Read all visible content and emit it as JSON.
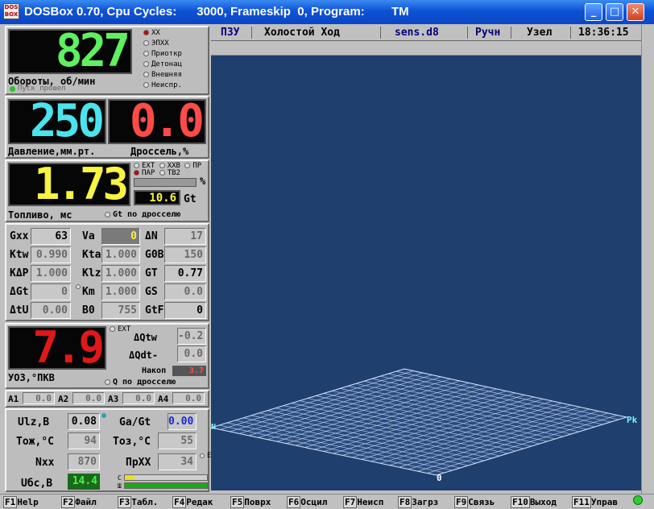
{
  "window": {
    "title": "DOSBox 0.70, Cpu Cycles:      3000, Frameskip  0, Program:        TM",
    "icon_text": [
      "DOS",
      "BOX"
    ]
  },
  "rpm": {
    "value": "827",
    "label": "Обороты, об/мин",
    "start_label": "Пуск прошел"
  },
  "modes": [
    "XX",
    "ЭПХХ",
    "Приоткр",
    "Детонац",
    "Внешняя",
    "Неиспр."
  ],
  "pressure": {
    "value": "250",
    "label": "Давление,мм.рт."
  },
  "throttle": {
    "value": "0.0",
    "label": "Дроссель,%"
  },
  "fuel": {
    "value": "1.73",
    "label": "Топливо, мс",
    "gt_value": "10.6",
    "gt_label": "Gt",
    "gt_throttle_label": "Gt по дросселю",
    "options": [
      "EXT",
      "XXB",
      "ПР",
      "ПАР",
      "ТВ2"
    ],
    "percent_label": "%"
  },
  "params": [
    {
      "n1": "Gxx",
      "v1": "63",
      "n2": "Va",
      "v2": "0",
      "n3": "ΔN",
      "v3": "17"
    },
    {
      "n1": "Ktw",
      "v1": "0.990",
      "n2": "Kta",
      "v2": "1.000",
      "n3": "G0B",
      "v3": "150"
    },
    {
      "n1": "KΔP",
      "v1": "1.000",
      "n2": "Klz",
      "v2": "1.000",
      "n3": "GT",
      "v3": "0.77"
    },
    {
      "n1": "ΔGt",
      "v1": "0",
      "n2": "Km",
      "v2": "1.000",
      "n3": "GS",
      "v3": "0.0"
    },
    {
      "n1": "ΔtU",
      "v1": "0.00",
      "n2": "B0",
      "v2": "755",
      "n3": "GtF",
      "v3": "0"
    }
  ],
  "ignition": {
    "value": "7.9",
    "label": "УОЗ,°ПКВ",
    "ext_label": "EXT",
    "dqtw_label": "ΔQtw",
    "dqtw_value": "-0.2",
    "dqdt_label": "ΔQdt-",
    "dqdt_value": "0.0",
    "nakop_label": "Накоп",
    "nakop_value": "3.7",
    "q_throttle_label": "Q по дросселю"
  },
  "a_vals": [
    {
      "name": "A1",
      "value": "0.0"
    },
    {
      "name": "A2",
      "value": "0.0"
    },
    {
      "name": "A3",
      "value": "0.0"
    },
    {
      "name": "A4",
      "value": "0.0"
    }
  ],
  "bottom": {
    "ulz_label": "Ulz,B",
    "ulz_value": "0.08",
    "gagt_label": "Ga/Gt",
    "gagt_value": "0.00",
    "tozh_label": "Tож,°C",
    "tozh_value": "94",
    "toz_label": "Tоз,°C",
    "toz_value": "55",
    "nxx_label": "Nxx",
    "nxx_value": "870",
    "prxx_label": "ПрXX",
    "prxx_value": "34",
    "ubs_label": "Uбс,B",
    "ubs_value": "14.4",
    "c_label": "C",
    "w_label": "Ш",
    "e_label": "E"
  },
  "status": {
    "pzu": "ПЗУ",
    "mode": "Холостой Ход",
    "file": "sens.d8",
    "hand": "Ручн",
    "node": "Узел",
    "time": "18:36:15"
  },
  "plot": {
    "x_label": "Pk",
    "origin_label": "0",
    "n_label": "N"
  },
  "fkeys": [
    {
      "key": "F1",
      "label": "Help"
    },
    {
      "key": "F2",
      "label": "Файл"
    },
    {
      "key": "F3",
      "label": "Табл."
    },
    {
      "key": "F4",
      "label": "Редак"
    },
    {
      "key": "F5",
      "label": "Поврх"
    },
    {
      "key": "F6",
      "label": "Осцил"
    },
    {
      "key": "F7",
      "label": "Неисп"
    },
    {
      "key": "F8",
      "label": "Загрз"
    },
    {
      "key": "F9",
      "label": "Связь"
    },
    {
      "key": "F10",
      "label": "Выход"
    },
    {
      "key": "F11",
      "label": "Управ"
    }
  ],
  "colors": {
    "rpm": "#5ff05f",
    "pressure": "#49e4ee",
    "throttle": "#ff4a4a",
    "fuel": "#f8f440",
    "ignition": "#e01818",
    "plot_bg": "#1f3f6e",
    "mesh": "#c8d8f0",
    "title_bar": "#0e52d6"
  }
}
